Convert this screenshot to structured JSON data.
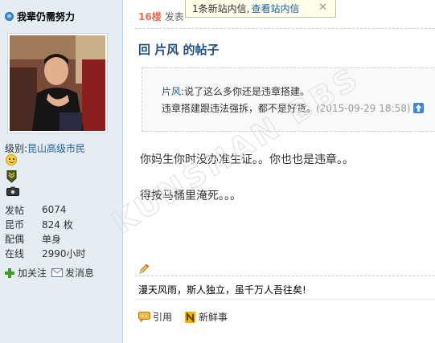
{
  "profile": {
    "username": "我辈仍需努力",
    "level_label": "级别:",
    "level_value": "昆山高级市民",
    "stats": [
      {
        "key": "发帖",
        "value": "6074"
      },
      {
        "key": "昆币",
        "value": "824 枚"
      },
      {
        "key": "配偶",
        "value": "单身"
      },
      {
        "key": "在线",
        "value": "2990小时"
      }
    ],
    "follow_label": "加关注",
    "message_label": "发消息"
  },
  "post": {
    "floor_number": "16楼",
    "floor_suffix": "发表",
    "title": "回 片风 的帖子",
    "quote": {
      "author": "片风",
      "line1_text": ":说了这么多你还是违章搭建。",
      "line2_text": "违章搭建跟违法强拆，都不是好货。",
      "timestamp": "(2015-09-29 18:58)"
    },
    "body_line1": "你妈生你时没办准生证。。你也也是违章。。",
    "body_line2": "得按马桶里淹死。。。",
    "signature": "漫天风雨，斯人独立，虽千万人吾往矣!",
    "actions": {
      "quote_label": "引用",
      "news_label": "新鲜事"
    }
  },
  "notification": {
    "message": "1条新站内信,",
    "link": "查看站内信",
    "close": "✕"
  },
  "watermark": "KUNSHAN BBS",
  "colors": {
    "sidebar_bg": "#e5edf2",
    "link_blue": "#1f5fa8",
    "floor_orange": "#f26c4f",
    "title_blue": "#1f4f86"
  },
  "icons": [
    "user-icon",
    "smile-icon",
    "medal-icon",
    "camera-icon",
    "plus-icon",
    "envelope-icon",
    "up-arrow-icon",
    "pencil-icon",
    "quote-icon",
    "news-icon",
    "close-icon"
  ]
}
